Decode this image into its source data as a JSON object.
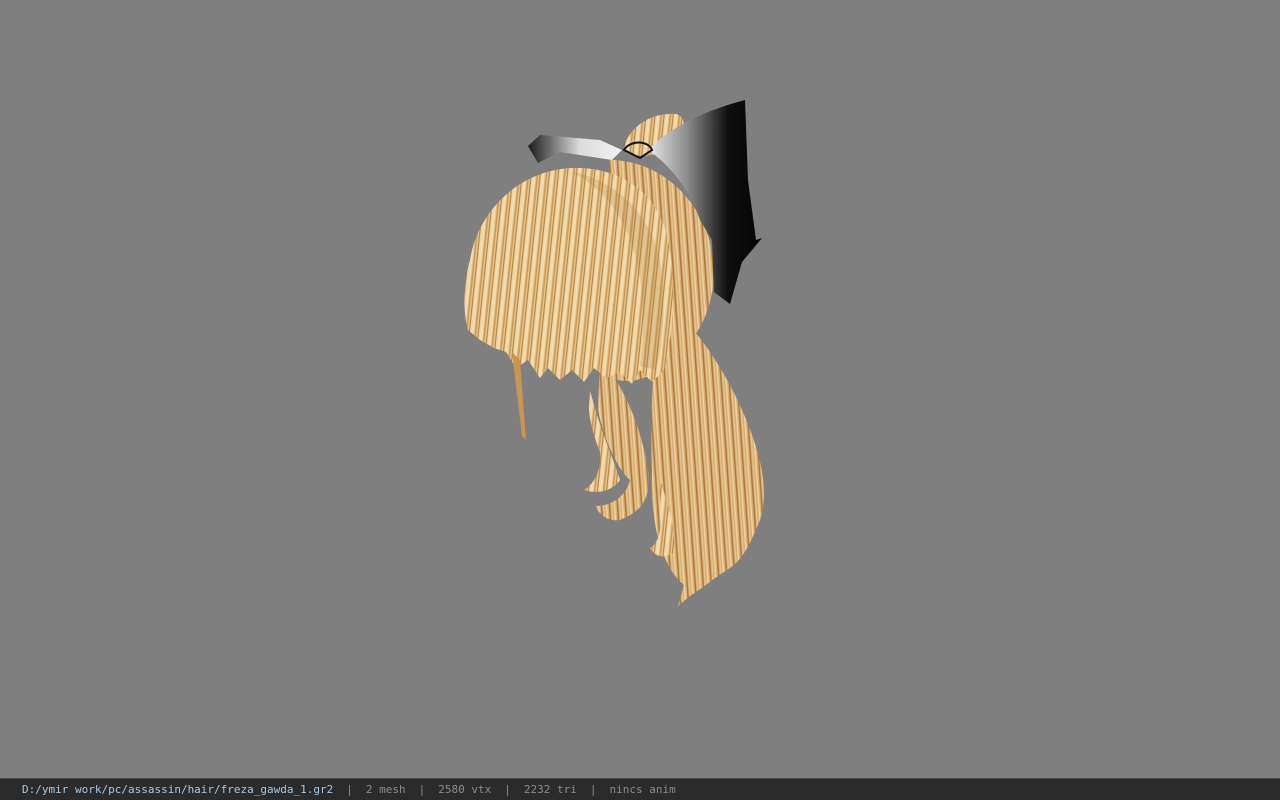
{
  "status_bar": {
    "file_path": "D:/ymir work/pc/assassin/hair/freza_gawda_1.gr2",
    "separator": "|",
    "mesh_count": "2 mesh",
    "vertex_count": "2580 vtx",
    "triangle_count": "2232 tri",
    "anim_status": "nincs anim"
  },
  "viewport": {
    "background": "#7f7f7f",
    "model": "hair-mesh"
  },
  "colors": {
    "hair_light": "#e8cfa0",
    "hair_mid": "#d4a96a",
    "hair_dark": "#b5823f",
    "ribbon": "#111111"
  }
}
